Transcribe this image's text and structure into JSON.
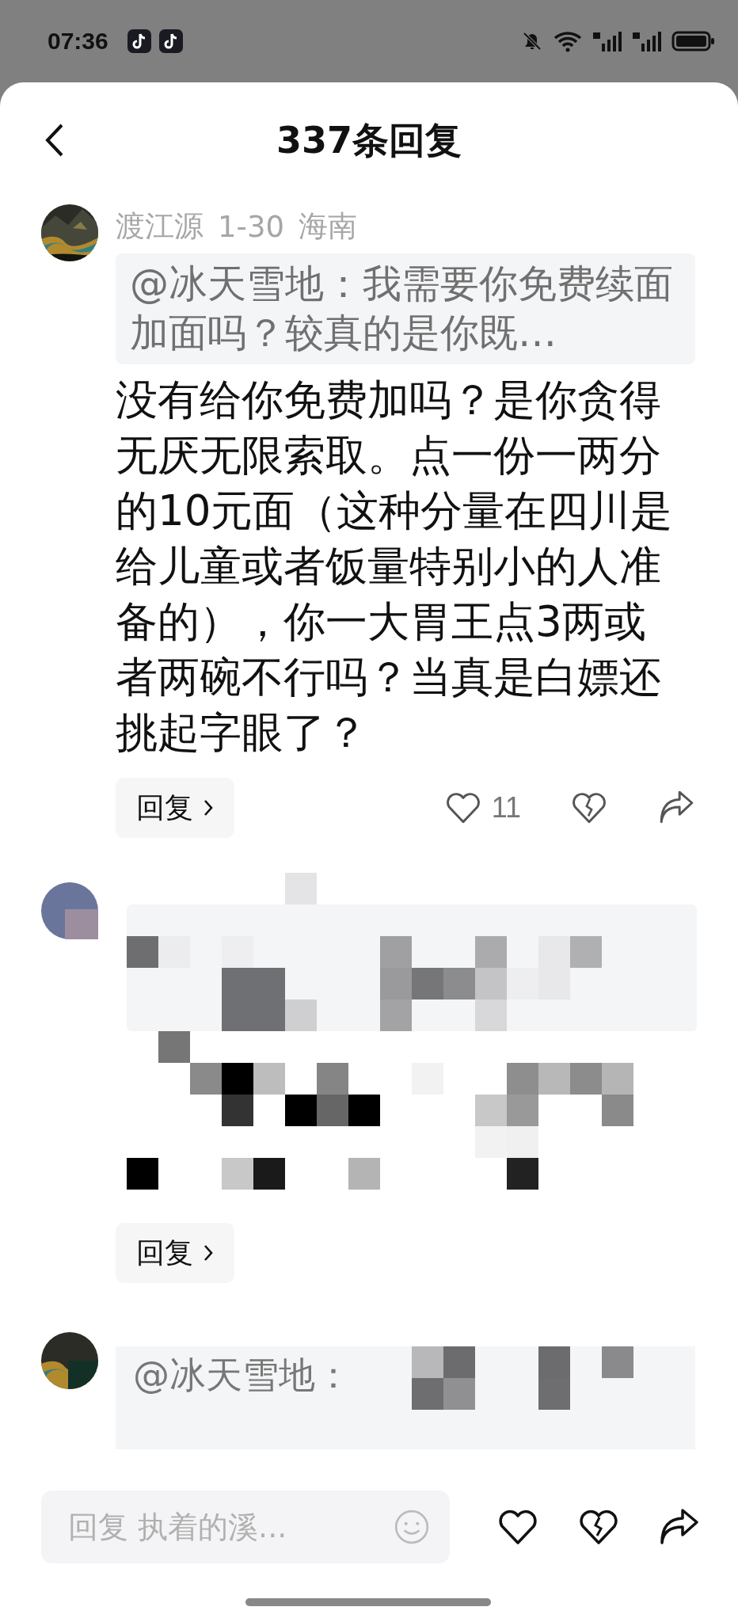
{
  "status_bar": {
    "time": "07:36"
  },
  "header": {
    "title": "337条回复"
  },
  "comments": [
    {
      "kind": "full",
      "author": "渡江源",
      "date": "1-30",
      "location": "海南",
      "quote": "@冰天雪地：我需要你免费续面加面吗？较真的是你既…",
      "body": "没有给你免费加吗？是你贪得无厌无限索取。点一份一两分的10元面（这种分量在四川是给儿童或者饭量特别小的人准备的），你一大胃王点3两或者两碗不行吗？当真是白嫖还挑起字眼了？",
      "reply_label": "回复",
      "likes": "11"
    },
    {
      "kind": "obscured",
      "reply_label": "回复"
    },
    {
      "kind": "obscured_quote",
      "quote": "@冰天雪地："
    }
  ],
  "composer": {
    "placeholder": "回复 执着的溪..."
  }
}
